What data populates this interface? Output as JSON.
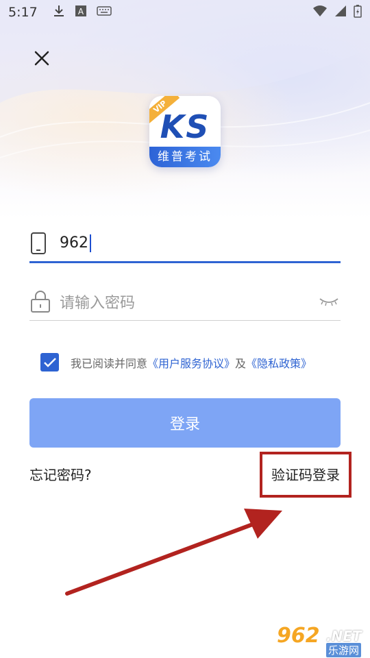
{
  "status_bar": {
    "time": "5:17",
    "icons_left": [
      "download-icon",
      "a-box-icon",
      "keyboard-icon"
    ],
    "icons_right": [
      "wifi-icon",
      "signal-icon",
      "battery-charging-icon"
    ]
  },
  "header": {
    "close_icon": "close-icon"
  },
  "logo": {
    "badge": "VIP",
    "letters": "KS",
    "band_text": "维普考试",
    "accent": "#2e63d2"
  },
  "form": {
    "phone": {
      "icon": "phone-icon",
      "value": "962"
    },
    "password": {
      "icon": "lock-icon",
      "placeholder": "请输入密码",
      "toggle_icon": "eye-closed-icon"
    },
    "agreement": {
      "checked": true,
      "prefix": "我已阅读并同意",
      "terms_link": "《用户服务协议》",
      "and": "及",
      "privacy_link": "《隐私政策》"
    },
    "submit_label": "登录",
    "submit_color": "#7ea5f5"
  },
  "footer_links": {
    "forgot": "忘记密码?",
    "code_login": "验证码登录"
  },
  "annotation": {
    "highlight_color": "#b2231f"
  },
  "watermark": {
    "big": "962",
    "net": ".NET",
    "sub": "乐游网"
  }
}
